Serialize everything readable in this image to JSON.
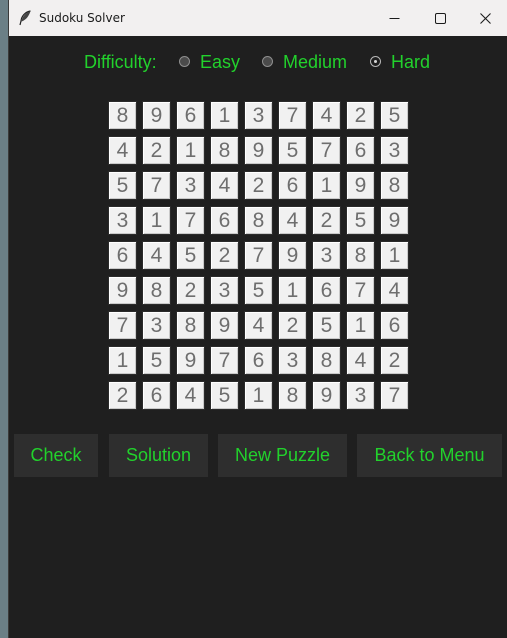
{
  "window": {
    "title": "Sudoku Solver"
  },
  "difficulty": {
    "label": "Difficulty:",
    "options": [
      {
        "label": "Easy",
        "selected": false
      },
      {
        "label": "Medium",
        "selected": false
      },
      {
        "label": "Hard",
        "selected": true
      }
    ]
  },
  "board": {
    "rows": [
      [
        8,
        9,
        6,
        1,
        3,
        7,
        4,
        2,
        5
      ],
      [
        4,
        2,
        1,
        8,
        9,
        5,
        7,
        6,
        3
      ],
      [
        5,
        7,
        3,
        4,
        2,
        6,
        1,
        9,
        8
      ],
      [
        3,
        1,
        7,
        6,
        8,
        4,
        2,
        5,
        9
      ],
      [
        6,
        4,
        5,
        2,
        7,
        9,
        3,
        8,
        1
      ],
      [
        9,
        8,
        2,
        3,
        5,
        1,
        6,
        7,
        4
      ],
      [
        7,
        3,
        8,
        9,
        4,
        2,
        5,
        1,
        6
      ],
      [
        1,
        5,
        9,
        7,
        6,
        3,
        8,
        4,
        2
      ],
      [
        2,
        6,
        4,
        5,
        1,
        8,
        9,
        3,
        7
      ]
    ]
  },
  "buttons": {
    "check": "Check",
    "solution": "Solution",
    "new_puzzle": "New Puzzle",
    "back_to_menu": "Back to Menu"
  },
  "colors": {
    "accent_green": "#22d12c",
    "window_bg": "#1f1f1f",
    "button_bg": "#2e2e2e",
    "cell_bg": "#f1f1f1",
    "cell_text": "#6e6e6e"
  },
  "icons": {
    "app": "feather-icon",
    "minimize": "minimize-icon",
    "maximize": "maximize-icon",
    "close": "close-icon"
  }
}
